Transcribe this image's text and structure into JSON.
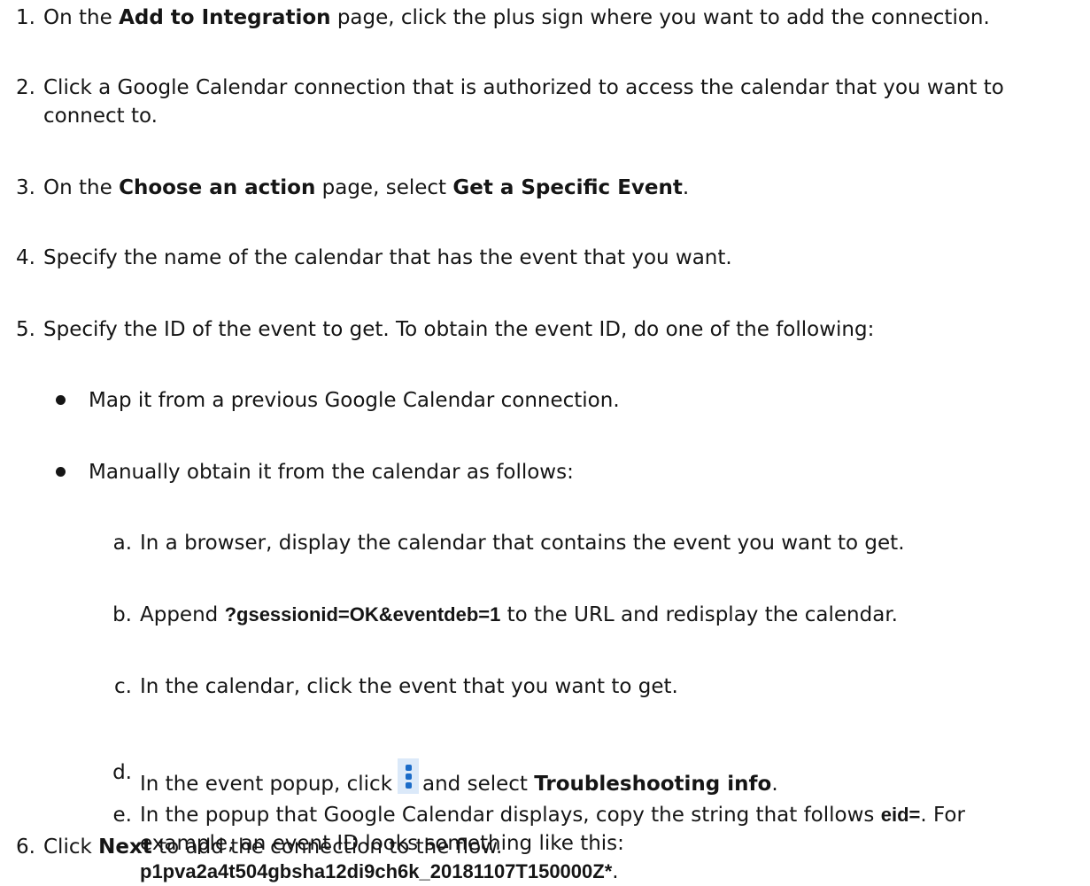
{
  "steps": {
    "s1": {
      "num": "1.",
      "pre": "On the ",
      "b1": "Add to Integration",
      "post": " page, click the plus sign where you want to add the connection."
    },
    "s2": {
      "num": "2.",
      "text": "Click a Google Calendar connection that is authorized to access the calendar that you want to connect to."
    },
    "s3": {
      "num": "3.",
      "pre": "On the ",
      "b1": "Choose an action",
      "mid": " page, select ",
      "b2": "Get a Specific Event",
      "post": "."
    },
    "s4": {
      "num": "4.",
      "text": "Specify the name of the calendar that has the event that you want."
    },
    "s5": {
      "num": "5.",
      "text": "Specify the ID of the event to get. To obtain the event ID, do one of the following:"
    },
    "s6": {
      "num": "6.",
      "pre": "Click ",
      "b1": "Next",
      "post": " to add the connection to the flow."
    }
  },
  "bullets": [
    "Map it from a previous Google Calendar connection.",
    "Manually obtain it from the calendar as follows:"
  ],
  "substeps": {
    "a": {
      "letter": "a.",
      "text": "In a browser, display the calendar that contains the event you want to get."
    },
    "b": {
      "letter": "b.",
      "pre": "Append ",
      "code": "?gsessionid=OK&eventdeb=1",
      "post": " to the URL and redisplay the calendar."
    },
    "c": {
      "letter": "c.",
      "text": "In the calendar, click the event that you want to get."
    },
    "d": {
      "letter": "d.",
      "pre": "In the event popup, click",
      "mid": "and select ",
      "b1": "Troubleshooting info",
      "post": ".",
      "icon": "kebab-menu-icon"
    },
    "e": {
      "letter": "e.",
      "pre": "In the popup that Google Calendar displays, copy the string that follows ",
      "code1": "eid=",
      "mid": ". For example, an event ID looks something like this: ",
      "code2": "p1pva2a4t504gbsha12di9ch6k_20181107T150000Z*",
      "post": "."
    }
  },
  "colors": {
    "text": "#151515",
    "icon_bg": "#dbe9f9",
    "icon_fg": "#1a6bc8"
  }
}
